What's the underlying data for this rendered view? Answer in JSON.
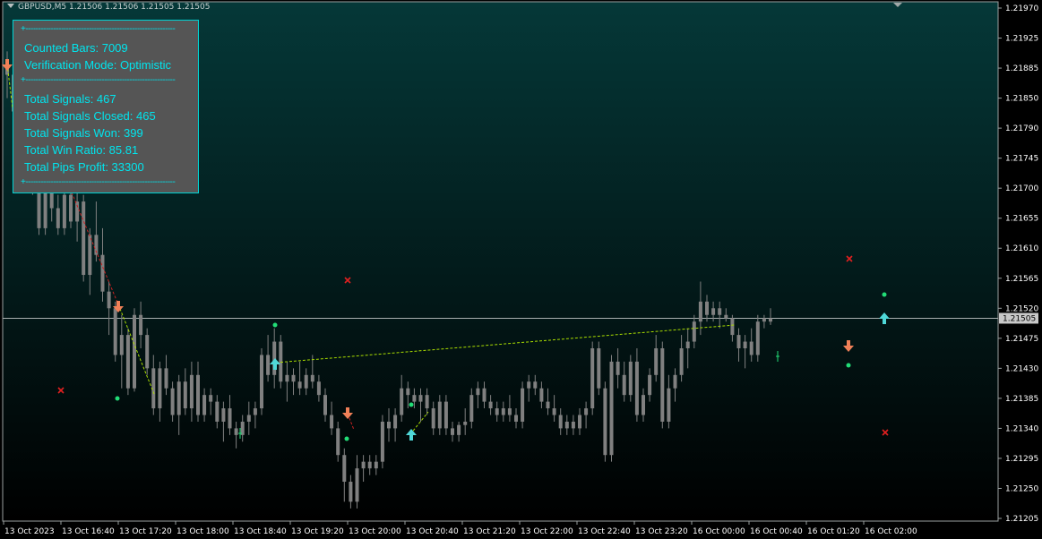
{
  "header": {
    "symbol_line": "GBPUSD,M5  1.21506 1.21506 1.21505 1.21505"
  },
  "stats_panel": {
    "separator": "+-----------------------------------------------------------",
    "counted_bars": "Counted Bars: 7009",
    "verification_mode": "Verification Mode: Optimistic",
    "total_signals": "Total Signals: 467",
    "signals_closed": "Total Signals Closed: 465",
    "signals_won": "Total Signals Won: 399",
    "win_ratio": "Total Win Ratio: 85.81",
    "pips_profit": "Total Pips Profit: 33300"
  },
  "price_axis": {
    "ticks": [
      "1.21970",
      "1.21925",
      "1.21885",
      "1.21850",
      "1.21790",
      "1.21745",
      "1.21700",
      "1.21655",
      "1.21610",
      "1.21565",
      "1.21520",
      "1.21475",
      "1.21430",
      "1.21385",
      "1.21340",
      "1.21295",
      "1.21250",
      "1.21205"
    ],
    "current_price": "1.21505"
  },
  "time_axis": {
    "ticks": [
      "13 Oct 2023",
      "13 Oct 16:40",
      "13 Oct 17:20",
      "13 Oct 18:00",
      "13 Oct 18:40",
      "13 Oct 19:20",
      "13 Oct 20:00",
      "13 Oct 20:40",
      "13 Oct 21:20",
      "13 Oct 22:00",
      "13 Oct 22:40",
      "13 Oct 23:20",
      "16 Oct 00:00",
      "16 Oct 00:40",
      "16 Oct 01:20",
      "16 Oct 02:00"
    ]
  },
  "colors": {
    "bg_top": "#053838",
    "bg_bottom": "#000000",
    "candle": "#808080",
    "axis_text": "#ffffff",
    "arrow_up": "#4fd8d8",
    "arrow_down": "#f08058",
    "dot_green": "#22dd77",
    "cross_red": "#e02020",
    "line_green": "#aadd00",
    "line_red": "#cc2222",
    "panel_bg": "#555555",
    "panel_border": "#00d4d4",
    "panel_text": "#00e5ee"
  },
  "chart_data": {
    "type": "candlestick",
    "symbol": "GBPUSD",
    "timeframe": "M5",
    "ylim": [
      1.2119,
      1.2199
    ],
    "current_price": 1.21505,
    "candles": [
      [
        1.2188,
        1.21905,
        1.21835,
        1.2187
      ],
      [
        1.2187,
        1.21895,
        1.218,
        1.21815
      ],
      [
        1.21815,
        1.2184,
        1.2176,
        1.2178
      ],
      [
        1.2178,
        1.2179,
        1.2172,
        1.2174
      ],
      [
        1.2174,
        1.2176,
        1.2169,
        1.2171
      ],
      [
        1.2171,
        1.2173,
        1.2163,
        1.2164
      ],
      [
        1.2164,
        1.2172,
        1.2163,
        1.217
      ],
      [
        1.217,
        1.2171,
        1.2165,
        1.2167
      ],
      [
        1.2167,
        1.2169,
        1.2163,
        1.2164
      ],
      [
        1.2164,
        1.217,
        1.2163,
        1.2169
      ],
      [
        1.2169,
        1.2173,
        1.2164,
        1.2165
      ],
      [
        1.2165,
        1.217,
        1.2162,
        1.2168
      ],
      [
        1.2168,
        1.2169,
        1.2156,
        1.2157
      ],
      [
        1.2157,
        1.2164,
        1.2154,
        1.2163
      ],
      [
        1.2163,
        1.2168,
        1.2159,
        1.216
      ],
      [
        1.216,
        1.2164,
        1.2153,
        1.21545
      ],
      [
        1.21545,
        1.2156,
        1.2148,
        1.2152
      ],
      [
        1.2152,
        1.2153,
        1.2144,
        1.2145
      ],
      [
        1.2145,
        1.2151,
        1.214,
        1.2148
      ],
      [
        1.2148,
        1.2149,
        1.2139,
        1.214
      ],
      [
        1.214,
        1.2152,
        1.21395,
        1.2151
      ],
      [
        1.2151,
        1.2153,
        1.2146,
        1.2148
      ],
      [
        1.2148,
        1.2149,
        1.2142,
        1.2143
      ],
      [
        1.2143,
        1.2145,
        1.2136,
        1.2137
      ],
      [
        1.2137,
        1.2144,
        1.2135,
        1.2143
      ],
      [
        1.2143,
        1.2145,
        1.2139,
        1.214
      ],
      [
        1.214,
        1.2141,
        1.2135,
        1.2136
      ],
      [
        1.2136,
        1.2142,
        1.2133,
        1.2141
      ],
      [
        1.2141,
        1.2143,
        1.2136,
        1.2137
      ],
      [
        1.2137,
        1.2144,
        1.2135,
        1.2142
      ],
      [
        1.2142,
        1.2144,
        1.2135,
        1.2136
      ],
      [
        1.2136,
        1.214,
        1.2135,
        1.2139
      ],
      [
        1.2139,
        1.214,
        1.2136,
        1.2138
      ],
      [
        1.2138,
        1.2139,
        1.2134,
        1.2135
      ],
      [
        1.2135,
        1.2138,
        1.2132,
        1.2137
      ],
      [
        1.2137,
        1.2139,
        1.2133,
        1.2134
      ],
      [
        1.2134,
        1.2135,
        1.2131,
        1.2133
      ],
      [
        1.2133,
        1.2136,
        1.2132,
        1.2135
      ],
      [
        1.2135,
        1.2138,
        1.2133,
        1.2136
      ],
      [
        1.2136,
        1.2138,
        1.2134,
        1.2137
      ],
      [
        1.2137,
        1.2146,
        1.2136,
        1.2145
      ],
      [
        1.2145,
        1.2148,
        1.2141,
        1.2142
      ],
      [
        1.2142,
        1.2149,
        1.214,
        1.2147
      ],
      [
        1.2147,
        1.2148,
        1.214,
        1.2141
      ],
      [
        1.2141,
        1.2144,
        1.2138,
        1.2142
      ],
      [
        1.2142,
        1.2143,
        1.2139,
        1.2141
      ],
      [
        1.2141,
        1.2144,
        1.2139,
        1.214
      ],
      [
        1.214,
        1.2143,
        1.2139,
        1.2142
      ],
      [
        1.2142,
        1.2145,
        1.214,
        1.2141
      ],
      [
        1.2141,
        1.2142,
        1.2138,
        1.2139
      ],
      [
        1.2139,
        1.214,
        1.2135,
        1.2136
      ],
      [
        1.2136,
        1.2138,
        1.2133,
        1.2134
      ],
      [
        1.2134,
        1.2135,
        1.2129,
        1.213
      ],
      [
        1.213,
        1.2131,
        1.2123,
        1.2126
      ],
      [
        1.2126,
        1.2127,
        1.2122,
        1.2123
      ],
      [
        1.2123,
        1.213,
        1.2122,
        1.2128
      ],
      [
        1.2128,
        1.213,
        1.2126,
        1.2129
      ],
      [
        1.2129,
        1.213,
        1.2127,
        1.2128
      ],
      [
        1.2128,
        1.213,
        1.2127,
        1.2129
      ],
      [
        1.2129,
        1.2136,
        1.2128,
        1.2135
      ],
      [
        1.2135,
        1.2137,
        1.2132,
        1.2134
      ],
      [
        1.2134,
        1.2137,
        1.2132,
        1.2136
      ],
      [
        1.2136,
        1.2142,
        1.2135,
        1.214
      ],
      [
        1.214,
        1.2141,
        1.2137,
        1.2139
      ],
      [
        1.2139,
        1.214,
        1.2137,
        1.2138
      ],
      [
        1.2138,
        1.214,
        1.2135,
        1.2139
      ],
      [
        1.2139,
        1.214,
        1.2136,
        1.2137
      ],
      [
        1.2137,
        1.2138,
        1.2133,
        1.2134
      ],
      [
        1.2134,
        1.2139,
        1.2133,
        1.2138
      ],
      [
        1.2138,
        1.2139,
        1.2133,
        1.2134
      ],
      [
        1.2134,
        1.2135,
        1.2132,
        1.2133
      ],
      [
        1.2133,
        1.2135,
        1.2132,
        1.21345
      ],
      [
        1.21345,
        1.2137,
        1.2133,
        1.2135
      ],
      [
        1.2135,
        1.214,
        1.2134,
        1.2139
      ],
      [
        1.2139,
        1.2141,
        1.2137,
        1.214
      ],
      [
        1.214,
        1.2141,
        1.2137,
        1.2138
      ],
      [
        1.2138,
        1.2139,
        1.2136,
        1.2137
      ],
      [
        1.2137,
        1.2138,
        1.2135,
        1.2136
      ],
      [
        1.2136,
        1.2138,
        1.2135,
        1.2137
      ],
      [
        1.2137,
        1.2139,
        1.2135,
        1.2136
      ],
      [
        1.2136,
        1.2137,
        1.2134,
        1.2135
      ],
      [
        1.2135,
        1.2141,
        1.2134,
        1.214
      ],
      [
        1.214,
        1.2142,
        1.2138,
        1.2141
      ],
      [
        1.2141,
        1.2142,
        1.2139,
        1.214
      ],
      [
        1.214,
        1.2141,
        1.2137,
        1.2138
      ],
      [
        1.2138,
        1.214,
        1.2136,
        1.2137
      ],
      [
        1.2137,
        1.2139,
        1.2135,
        1.2136
      ],
      [
        1.2136,
        1.2137,
        1.2133,
        1.2134
      ],
      [
        1.2134,
        1.2136,
        1.2133,
        1.2135
      ],
      [
        1.2135,
        1.2136,
        1.2133,
        1.2134
      ],
      [
        1.2134,
        1.2137,
        1.2133,
        1.2136
      ],
      [
        1.2136,
        1.2138,
        1.2134,
        1.2137
      ],
      [
        1.2137,
        1.2147,
        1.2136,
        1.2146
      ],
      [
        1.2146,
        1.2147,
        1.2139,
        1.214
      ],
      [
        1.214,
        1.2141,
        1.2129,
        1.213
      ],
      [
        1.213,
        1.2145,
        1.2129,
        1.2144
      ],
      [
        1.2144,
        1.2146,
        1.214,
        1.2142
      ],
      [
        1.2142,
        1.2144,
        1.2138,
        1.2139
      ],
      [
        1.2139,
        1.2145,
        1.2138,
        1.2144
      ],
      [
        1.2144,
        1.2146,
        1.2135,
        1.2136
      ],
      [
        1.2136,
        1.214,
        1.2135,
        1.2139
      ],
      [
        1.2139,
        1.2143,
        1.2138,
        1.2142
      ],
      [
        1.2142,
        1.2148,
        1.2141,
        1.2146
      ],
      [
        1.2146,
        1.2147,
        1.2134,
        1.2135
      ],
      [
        1.2135,
        1.2142,
        1.2134,
        1.214
      ],
      [
        1.214,
        1.2143,
        1.2138,
        1.2142
      ],
      [
        1.2142,
        1.2148,
        1.2141,
        1.2146
      ],
      [
        1.2146,
        1.2149,
        1.2143,
        1.2147
      ],
      [
        1.2147,
        1.2151,
        1.2146,
        1.215
      ],
      [
        1.215,
        1.2156,
        1.2148,
        1.2153
      ],
      [
        1.2153,
        1.2154,
        1.215,
        1.2151
      ],
      [
        1.2151,
        1.2153,
        1.215,
        1.2152
      ],
      [
        1.2152,
        1.2153,
        1.2149,
        1.2151
      ],
      [
        1.2151,
        1.2152,
        1.215,
        1.21505
      ],
      [
        1.21505,
        1.2151,
        1.2147,
        1.2148
      ],
      [
        1.2148,
        1.2149,
        1.2144,
        1.2146
      ],
      [
        1.2146,
        1.2148,
        1.2143,
        1.2147
      ],
      [
        1.2147,
        1.2149,
        1.2144,
        1.2145
      ],
      [
        1.2145,
        1.2151,
        1.2144,
        1.215
      ],
      [
        1.215,
        1.2151,
        1.2149,
        1.21505
      ],
      [
        1.21505,
        1.2152,
        1.21495,
        1.215
      ]
    ]
  }
}
